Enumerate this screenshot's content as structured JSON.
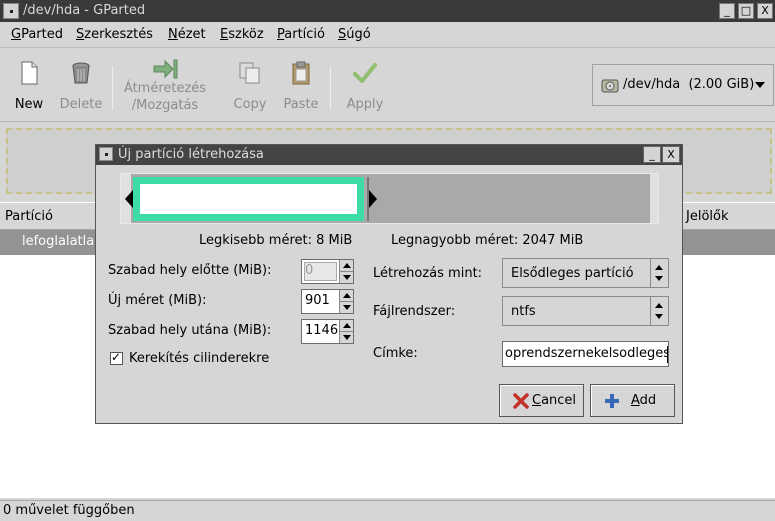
{
  "window": {
    "title": "/dev/hda - GParted",
    "minimize": "_",
    "maximize": "□",
    "close": "X"
  },
  "menu": [
    {
      "pre": "",
      "u": "G",
      "post": "Parted"
    },
    {
      "pre": "",
      "u": "S",
      "post": "zerkesztés"
    },
    {
      "pre": "",
      "u": "N",
      "post": "ézet"
    },
    {
      "pre": "",
      "u": "E",
      "post": "szköz"
    },
    {
      "pre": "",
      "u": "P",
      "post": "artíció"
    },
    {
      "pre": "",
      "u": "S",
      "post": "úgó"
    }
  ],
  "toolbar": {
    "new": "New",
    "delete": "Delete",
    "resize_line1": "Átméretezés",
    "resize_line2": "/Mozgatás",
    "copy": "Copy",
    "paste": "Paste",
    "apply": "Apply"
  },
  "device": {
    "name": "/dev/hda",
    "size": "(2.00 GiB)"
  },
  "list": {
    "col_partition": "Partíció",
    "col_flags": "Jelölők",
    "row_label": "lefoglalatlan"
  },
  "status": {
    "text": "0 művelet függőben"
  },
  "dialog": {
    "title": "Új partíció létrehozása",
    "min_size": "Legkisebb méret: 8 MiB",
    "max_size": "Legnagyobb méret: 2047 MiB",
    "free_before_label": "Szabad hely előtte (MiB):",
    "free_before_value": "0",
    "new_size_label": "Új méret (MiB):",
    "new_size_value": "901",
    "free_after_label": "Szabad hely utána (MiB):",
    "free_after_value": "1146",
    "round_label": "Kerekítés cilinderekre",
    "round_checked": true,
    "create_as_label": "Létrehozás mint:",
    "create_as_value": "Elsődleges partíció",
    "fs_label": "Fájlrendszer:",
    "fs_value": "ntfs",
    "label_label": "Címke:",
    "label_value": "oprendszernekelsodleges",
    "cancel_u": "C",
    "cancel_rest": "ancel",
    "add_u": "A",
    "add_rest": "dd"
  },
  "colors": {
    "partition_border": "#3ddca4",
    "titlebar": "#3a3a3a",
    "selected_row": "#939393"
  }
}
